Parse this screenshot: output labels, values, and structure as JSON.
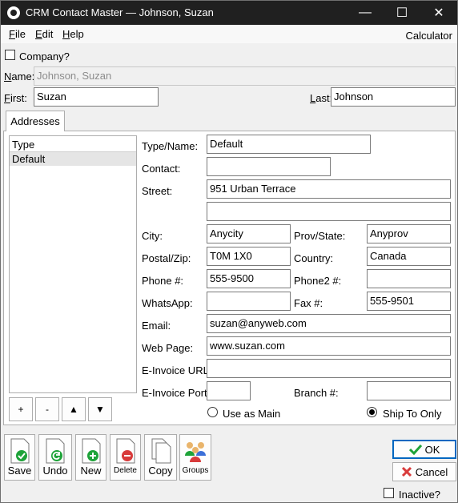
{
  "window": {
    "title": "CRM Contact Master — Johnson, Suzan",
    "minimize": "—",
    "maximize": "☐",
    "close": "✕"
  },
  "menu": {
    "file": "ile",
    "file_key": "F",
    "edit": "dit",
    "edit_key": "E",
    "help": "elp",
    "help_key": "H",
    "calculator": "Calculator"
  },
  "header": {
    "company_label": "Company?",
    "name_label_key": "N",
    "name_label": "ame:",
    "name_value": "Johnson, Suzan",
    "first_label_key": "F",
    "first_label": "irst:",
    "first_value": "Suzan",
    "last_label_key": "L",
    "last_label": "ast:",
    "last_value": "Johnson"
  },
  "tabs": {
    "addresses": "Addresses"
  },
  "address_list": {
    "column": "Type",
    "rows": [
      "Default"
    ]
  },
  "list_buttons": {
    "add": "+",
    "remove": "-",
    "up": "▲",
    "down": "▼"
  },
  "form": {
    "type_name_label": "Type/Name:",
    "type_name_value": "Default",
    "contact_label": "Contact:",
    "contact_value": "",
    "street_label": "Street:",
    "street_value": "951 Urban Terrace",
    "street2_value": "",
    "city_label": "City:",
    "city_value": "Anycity",
    "prov_label": "Prov/State:",
    "prov_value": "Anyprov",
    "postal_label": "Postal/Zip:",
    "postal_value": "T0M 1X0",
    "country_label": "Country:",
    "country_value": "Canada",
    "phone_label": "Phone #:",
    "phone_value": "555-9500",
    "phone2_label": "Phone2 #:",
    "phone2_value": "",
    "whatsapp_label": "WhatsApp:",
    "whatsapp_value": "",
    "fax_label": "Fax #:",
    "fax_value": "555-9501",
    "email_label": "Email:",
    "email_value": "suzan@anyweb.com",
    "web_label": "Web Page:",
    "web_value": "www.suzan.com",
    "einvoice_url_label": "E-Invoice URL:",
    "einvoice_url_value": "",
    "einvoice_port_label": "E-Invoice Port:",
    "einvoice_port_value": "",
    "branch_label": "Branch #:",
    "branch_value": "",
    "use_as_main_label": "Use as Main",
    "ship_to_only_label": "Ship To Only"
  },
  "toolbar": {
    "save": "Save",
    "undo": "Undo",
    "new": "New",
    "delete": "Delete",
    "copy": "Copy",
    "groups": "Groups"
  },
  "dialog": {
    "ok": "OK",
    "cancel": "Cancel",
    "inactive": "Inactive?"
  },
  "colors": {
    "titlebar": "#202020",
    "ok_border": "#0067c0",
    "green": "#1ea339",
    "red": "#d83b3b"
  }
}
